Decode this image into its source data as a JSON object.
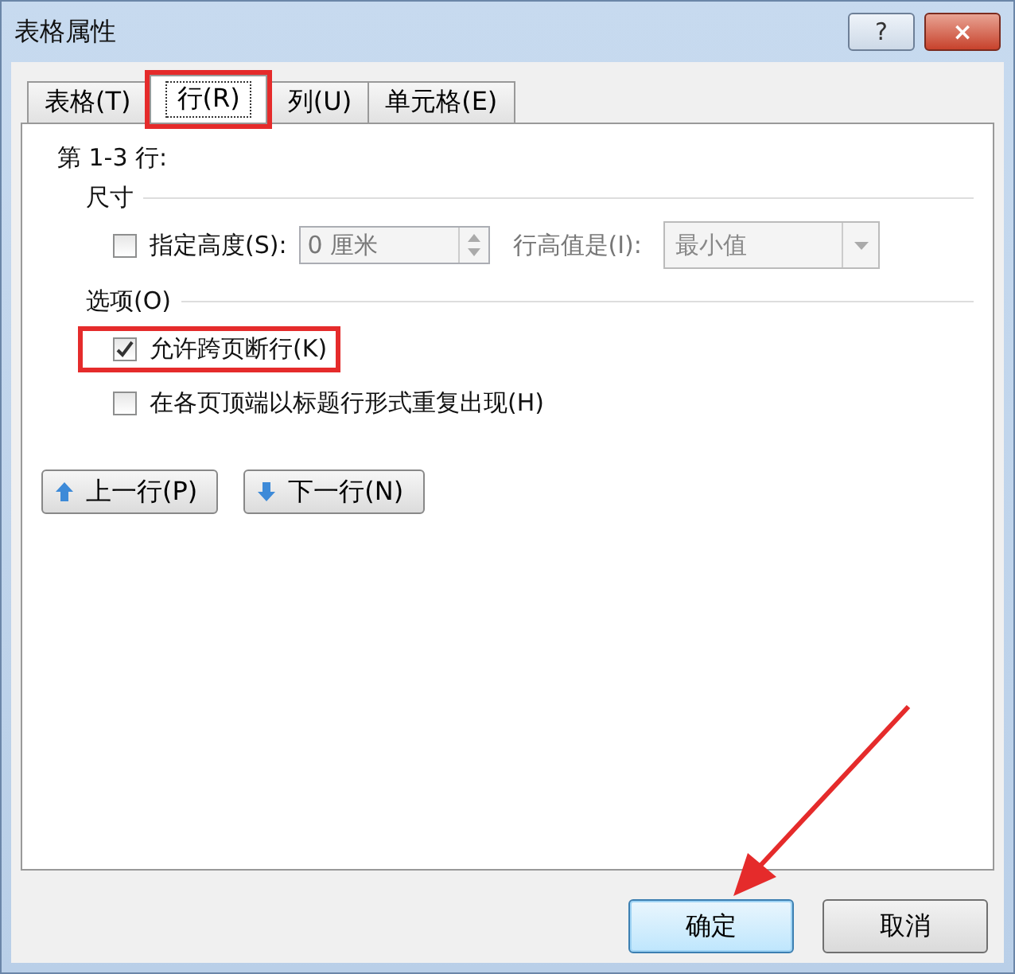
{
  "window": {
    "title": "表格属性"
  },
  "title_buttons": [
    {
      "kind": "help",
      "label": "?"
    },
    {
      "kind": "close",
      "label": "×"
    }
  ],
  "tabs": [
    {
      "label": "表格(T)",
      "selected": false,
      "highlighted": false
    },
    {
      "label": "行(R)",
      "selected": true,
      "highlighted": true
    },
    {
      "label": "列(U)",
      "selected": false,
      "highlighted": false
    },
    {
      "label": "单元格(E)",
      "selected": false,
      "highlighted": false
    }
  ],
  "rows_label": "第 1-3 行:",
  "size_section": {
    "title": "尺寸",
    "height_checkbox": {
      "label": "指定高度(S):",
      "checked": false
    },
    "height_value": "0 厘米",
    "height_rule_label": "行高值是(I):",
    "height_rule_value": "最小值"
  },
  "options_section": {
    "title": "选项(O)",
    "options": [
      {
        "label": "允许跨页断行(K)",
        "checked": true,
        "highlighted": true
      },
      {
        "label": "在各页顶端以标题行形式重复出现(H)",
        "checked": false,
        "highlighted": false
      }
    ]
  },
  "nav_buttons": [
    {
      "kind": "up",
      "label": "上一行(P)"
    },
    {
      "kind": "down",
      "label": "下一行(N)"
    }
  ],
  "footer_buttons": [
    {
      "label": "确定",
      "selected": true
    },
    {
      "label": "取消",
      "selected": false
    }
  ],
  "annotation_arrow": true
}
